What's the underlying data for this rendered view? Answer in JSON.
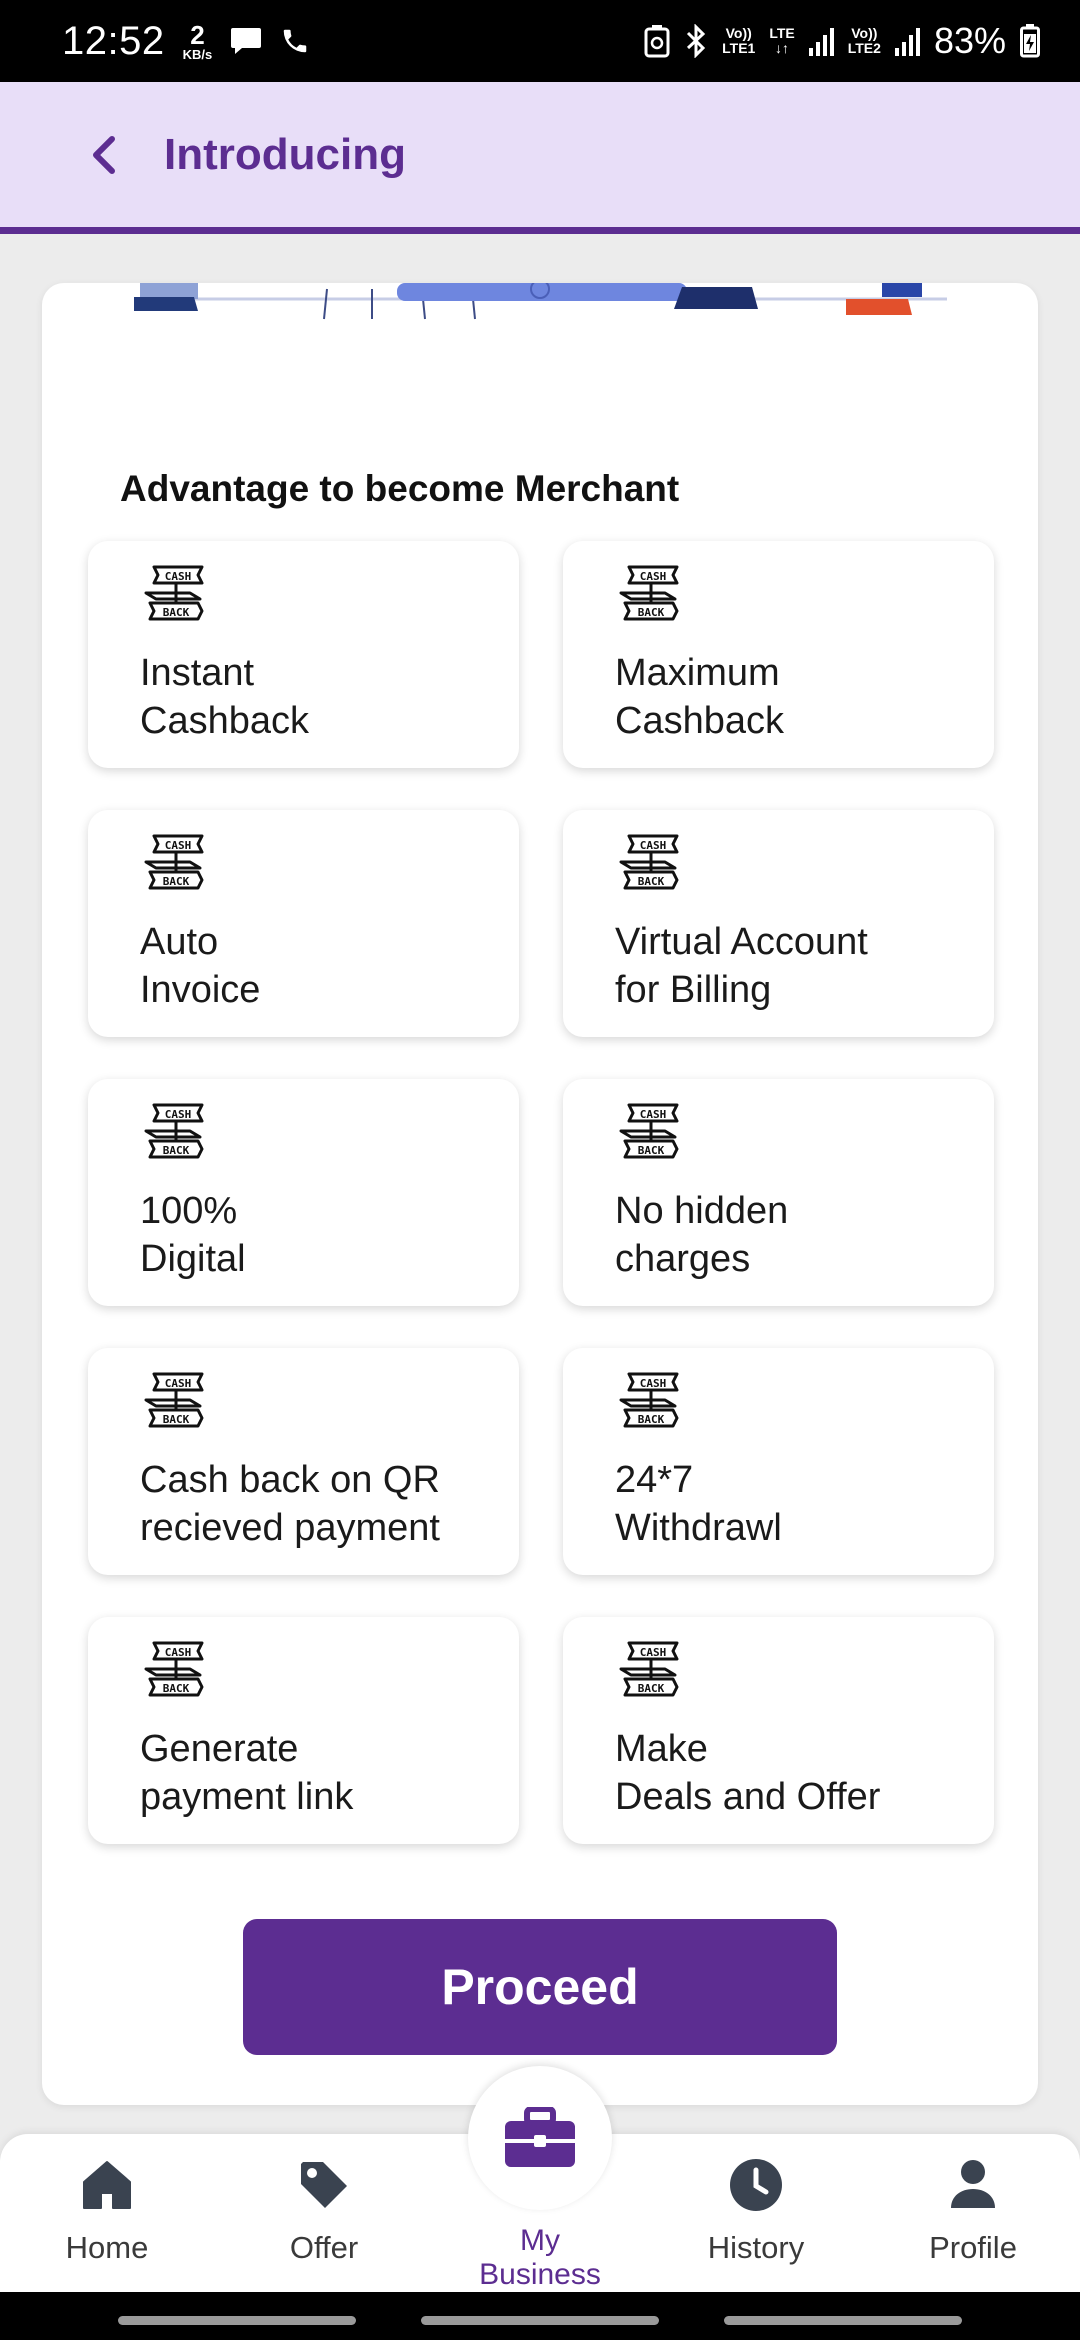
{
  "status_bar": {
    "time": "12:52",
    "data_rate": "2",
    "data_unit": "KB/s",
    "sim1": "Vo))\nLTE1",
    "lte": "LTE\n↓↑",
    "sim2": "Vo))\nLTE2",
    "battery": "83%"
  },
  "header": {
    "title": "Introducing"
  },
  "section": {
    "title": "Advantage to become Merchant"
  },
  "tiles": [
    {
      "label": "Instant\nCashback",
      "icon": "cashback-icon"
    },
    {
      "label": "Maximum\nCashback",
      "icon": "cashback-icon"
    },
    {
      "label": "Auto\nInvoice",
      "icon": "cashback-icon"
    },
    {
      "label": "Virtual Account\nfor Billing",
      "icon": "cashback-icon"
    },
    {
      "label": "100%\nDigital",
      "icon": "cashback-icon"
    },
    {
      "label": "No hidden\ncharges",
      "icon": "cashback-icon"
    },
    {
      "label": "Cash back on QR\nrecieved payment",
      "icon": "cashback-icon"
    },
    {
      "label": "24*7\nWithdrawl",
      "icon": "cashback-icon"
    },
    {
      "label": "Generate\npayment link",
      "icon": "cashback-icon"
    },
    {
      "label": "Make\nDeals and Offer",
      "icon": "cashback-icon"
    }
  ],
  "cashback_icon_text": {
    "top": "CASH",
    "bottom": "BACK"
  },
  "proceed_label": "Proceed",
  "nav": {
    "home": "Home",
    "offer": "Offer",
    "my_business": "My\nBusiness",
    "history": "History",
    "profile": "Profile"
  },
  "colors": {
    "brand": "#5c2d91",
    "header_bg": "#e8def8",
    "nav_icon": "#3a4350"
  }
}
